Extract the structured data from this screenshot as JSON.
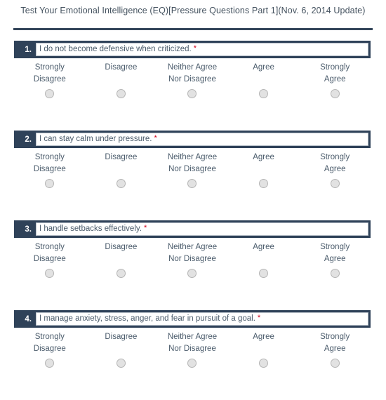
{
  "survey": {
    "title": "Test Your Emotional Intelligence (EQ)[Pressure Questions Part 1](Nov. 6, 2014 Update)",
    "required_marker": "*",
    "scale_labels": [
      "Strongly\nDisagree",
      "Disagree",
      "Neither Agree\nNor Disagree",
      "Agree",
      "Strongly\nAgree"
    ],
    "colors": {
      "bar": "#2f4259",
      "rule": "#34455a",
      "text": "#4a5b6b",
      "required": "#d0021b",
      "radio_fill": "#e2e2e2",
      "radio_border": "#b5b5b5"
    },
    "questions": [
      {
        "number": "1.",
        "text": "I do not become defensive when criticized.",
        "selected": null
      },
      {
        "number": "2.",
        "text": "I can stay calm under pressure.",
        "selected": null
      },
      {
        "number": "3.",
        "text": "I handle setbacks effectively.",
        "selected": null
      },
      {
        "number": "4.",
        "text": "I manage anxiety, stress, anger, and fear in pursuit of a goal.",
        "selected": null
      }
    ]
  }
}
